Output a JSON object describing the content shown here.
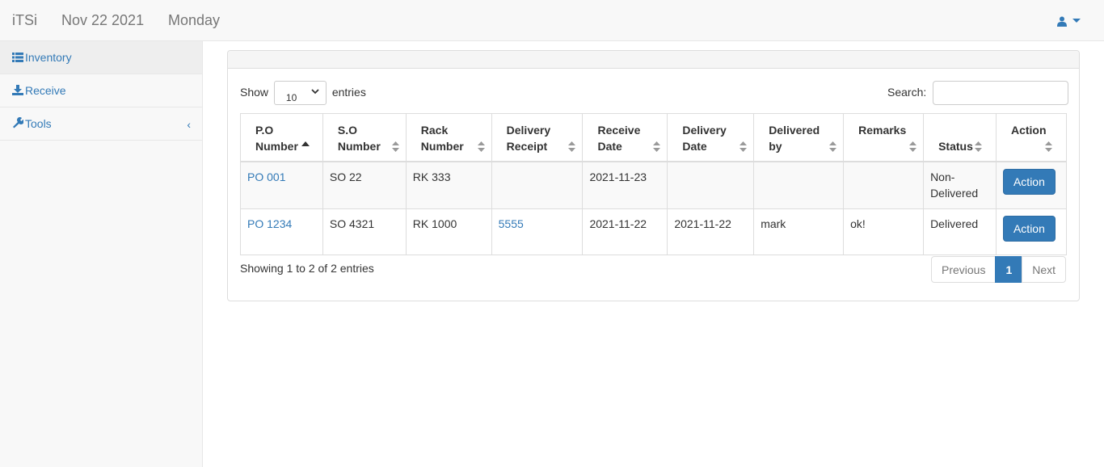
{
  "navbar": {
    "brand": "iTSi",
    "date": "Nov 22 2021",
    "day": "Monday"
  },
  "sidebar": {
    "items": [
      {
        "label": "Inventory",
        "icon": "list-icon"
      },
      {
        "label": "Receive",
        "icon": "download-icon"
      },
      {
        "label": "Tools",
        "icon": "wrench-icon",
        "chevron": "‹"
      }
    ]
  },
  "table_controls": {
    "show_label": "Show",
    "page_size": "10",
    "entries_label": "entries",
    "search_label": "Search:"
  },
  "table": {
    "columns": [
      [
        "P.O",
        "Number"
      ],
      [
        "S.O",
        "Number"
      ],
      [
        "Rack",
        "Number"
      ],
      [
        "Delivery",
        "Receipt"
      ],
      [
        "Receive",
        "Date"
      ],
      [
        "Delivery",
        "Date"
      ],
      [
        "Delivered",
        "by"
      ],
      [
        "Remarks",
        ""
      ],
      [
        "",
        "Status"
      ],
      [
        "Action",
        ""
      ]
    ],
    "rows": [
      {
        "po": "PO 001",
        "so": "SO 22",
        "rack": "RK 333",
        "receipt": "",
        "receive_date": "2021-11-23",
        "delivery_date": "",
        "delivered_by": "",
        "remarks": "",
        "status": "Non-Delivered",
        "action": "Action"
      },
      {
        "po": "PO 1234",
        "so": "SO 4321",
        "rack": "RK 1000",
        "receipt": "5555",
        "receive_date": "2021-11-22",
        "delivery_date": "2021-11-22",
        "delivered_by": "mark",
        "remarks": "ok!",
        "status": "Delivered",
        "action": "Action"
      }
    ]
  },
  "footer": {
    "info": "Showing 1 to 2 of 2 entries",
    "previous": "Previous",
    "current_page": "1",
    "next": "Next"
  },
  "colors": {
    "accent": "#337ab7",
    "navbar_bg": "#f8f8f8"
  }
}
